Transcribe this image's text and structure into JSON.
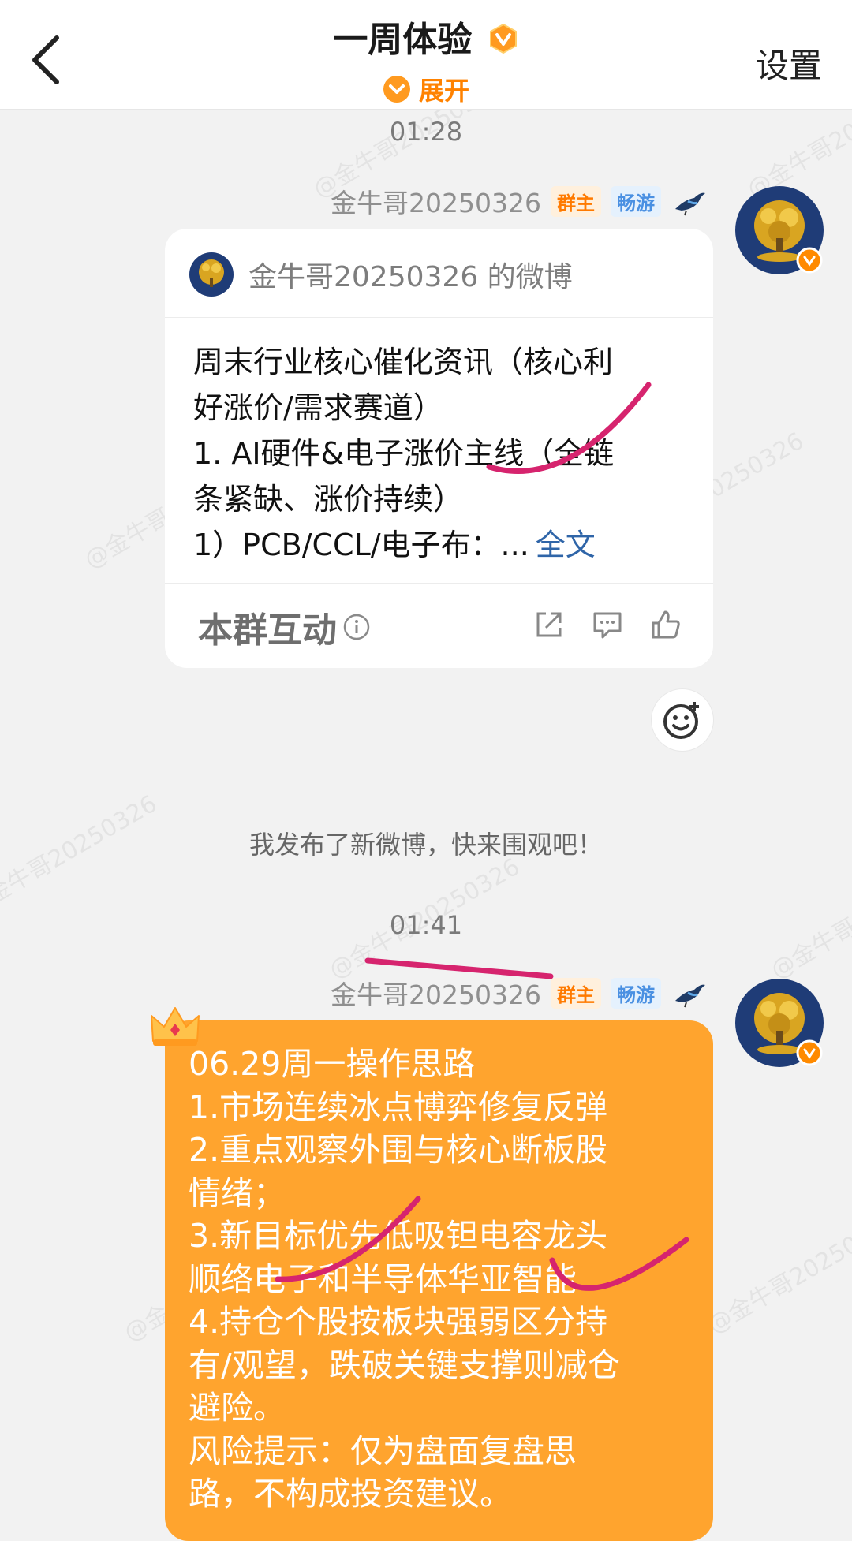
{
  "header": {
    "title": "一周体验",
    "expand_label": "展开",
    "settings_label": "设置"
  },
  "watermark": "@金牛哥20250326",
  "messages": [
    {
      "time": "01:28",
      "sender": "金牛哥20250326",
      "badges": [
        "群主",
        "畅游"
      ],
      "card": {
        "title": "金牛哥20250326 的微博",
        "lines": [
          "周末行业核心催化资讯（核心利",
          "好涨价/需求赛道）",
          "1. AI硬件&电子涨价主线（全链",
          "条紧缺、涨价持续）",
          "1）PCB/CCL/电子布：..."
        ],
        "full_text_link": "全文",
        "footer_label": "本群互动"
      },
      "system_text": "我发布了新微博，快来围观吧！"
    },
    {
      "time": "01:41",
      "sender": "金牛哥20250326",
      "badges": [
        "群主",
        "畅游"
      ],
      "bubble_lines": [
        "06.29周一操作思路",
        "1.市场连续冰点博弈修复反弹",
        "2.重点观察外围与核心断板股",
        "情绪；",
        "3.新目标优先低吸钽电容龙头",
        "顺络电子和半导体华亚智能",
        "4.持仓个股按板块强弱区分持",
        "有/观望，跌破关键支撑则减仓",
        "避险。",
        "风险提示：仅为盘面复盘思",
        "路，不构成投资建议。"
      ]
    }
  ],
  "colors": {
    "accent": "#ff8200",
    "bubble": "#ffa42e",
    "link": "#2f65a8",
    "scribble": "#d6246e"
  }
}
